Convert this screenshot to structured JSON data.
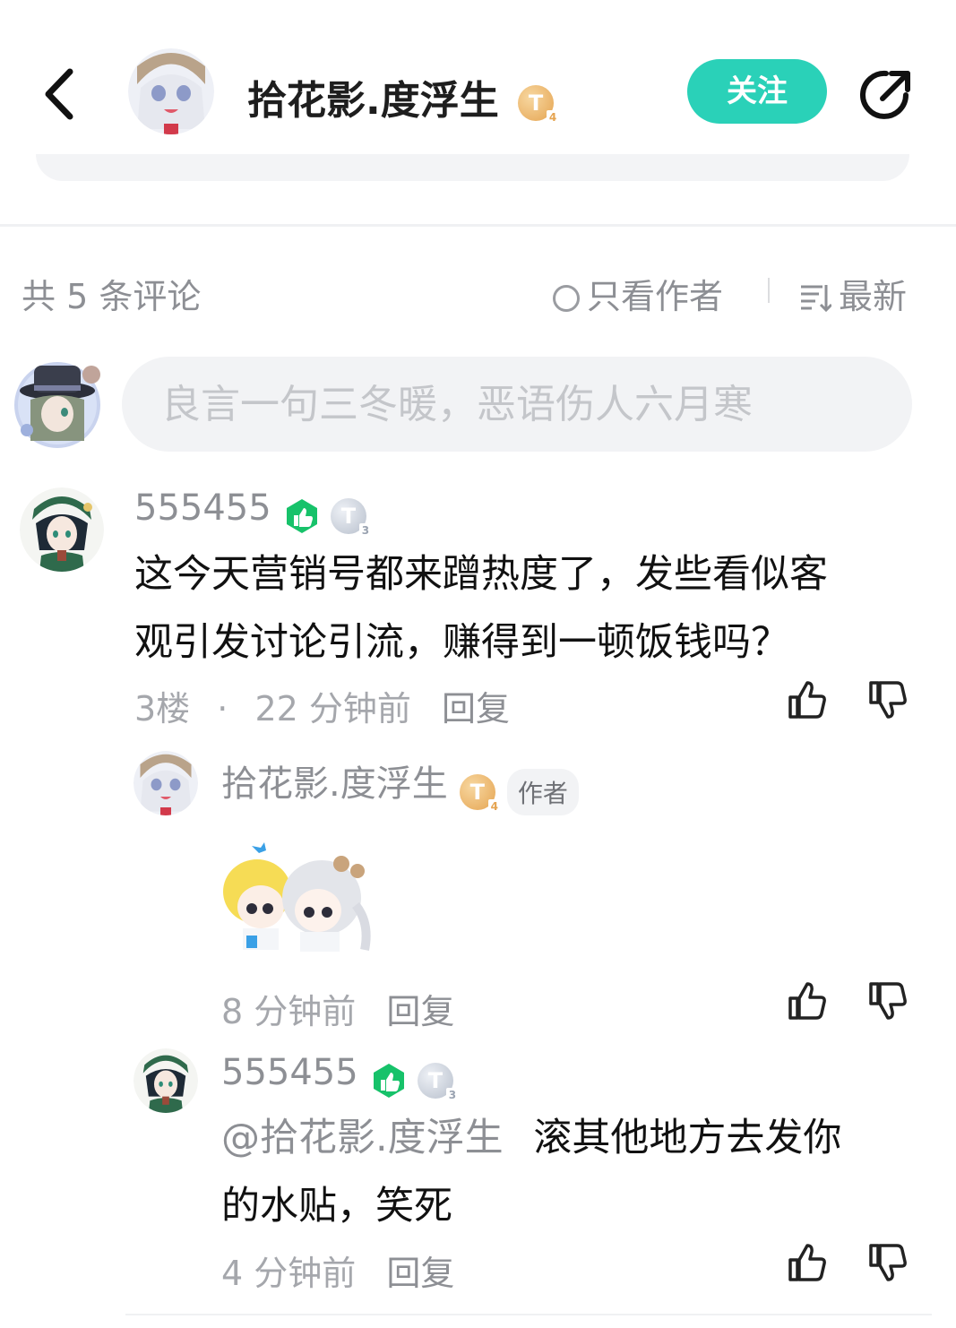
{
  "header": {
    "username": "拾花影.度浮生",
    "level_badge": "T",
    "level_sub": "4",
    "follow_label": "关注"
  },
  "filters": {
    "count_text": "共 5 条评论",
    "only_author_label": "只看作者",
    "sort_label": "最新"
  },
  "composer": {
    "placeholder": "良言一句三冬暖，恶语伤人六月寒"
  },
  "comments": [
    {
      "username": "555455",
      "level_badge": "T",
      "level_sub": "3",
      "text_line1": "这今天营销号都来蹭热度了，发些看似客",
      "text_line2": "观引发讨论引流，赚得到一顿饭钱吗？",
      "floor": "3楼",
      "dot": "·",
      "time": "22 分钟前",
      "reply_label": "回复"
    }
  ],
  "replies": [
    {
      "username": "拾花影.度浮生",
      "level_badge": "T",
      "level_sub": "4",
      "author_tag": "作者",
      "time": "8 分钟前",
      "reply_label": "回复"
    },
    {
      "username": "555455",
      "level_badge": "T",
      "level_sub": "3",
      "mention": "@拾花影.度浮生",
      "text_line1": "滚其他地方去发你",
      "text_line2": "的水贴，笑死",
      "time": "4 分钟前",
      "reply_label": "回复"
    }
  ],
  "colors": {
    "accent": "#2ad1b8",
    "muted_text": "#8d8f94",
    "badge_green": "#17c26a"
  }
}
